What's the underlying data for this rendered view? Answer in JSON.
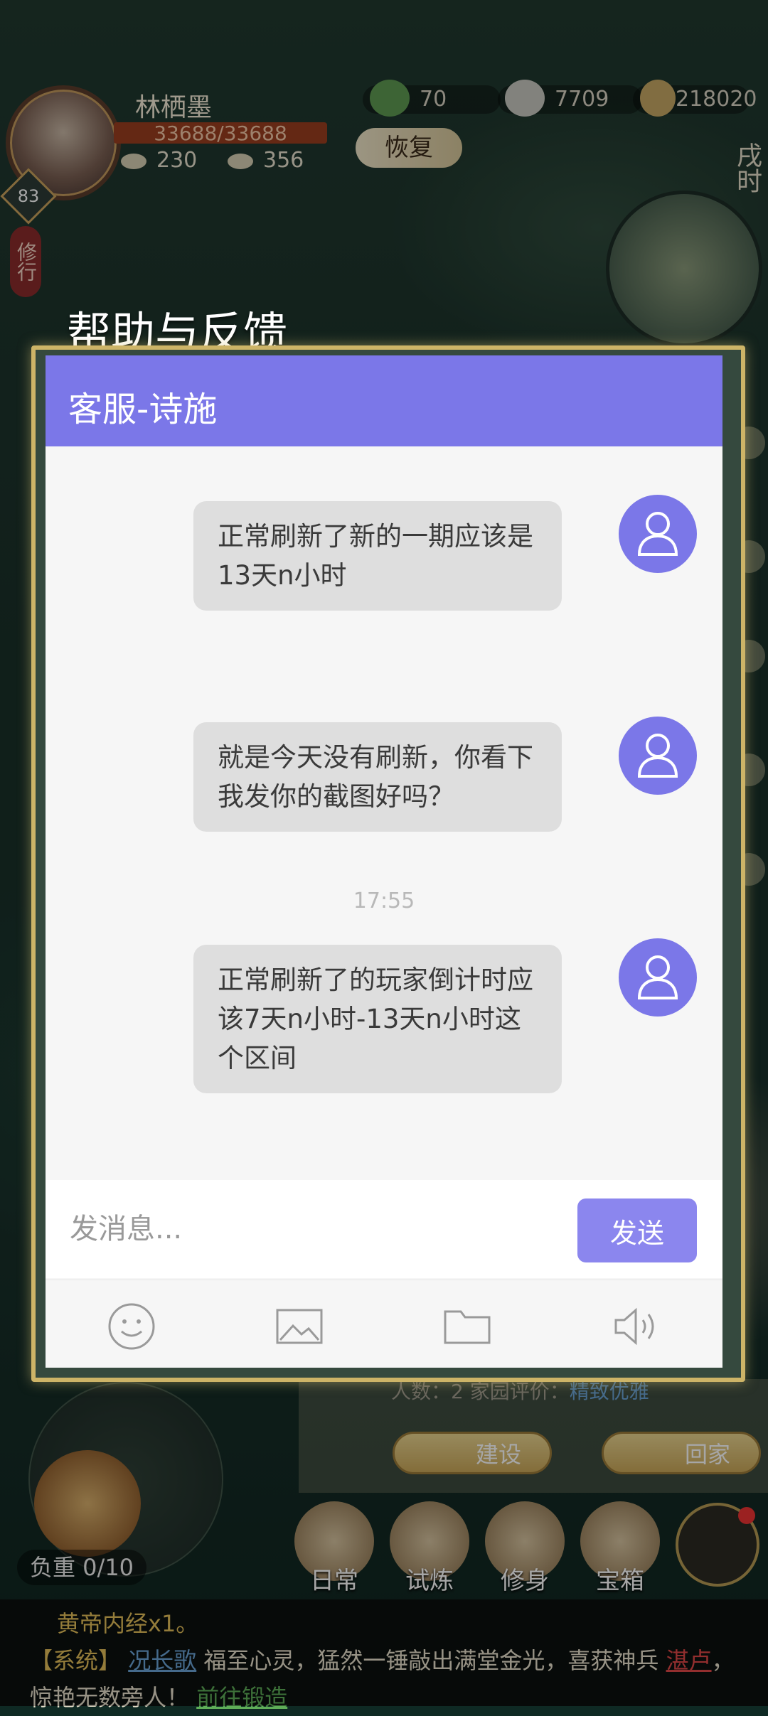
{
  "hud": {
    "player_name": "林栖墨",
    "hp": "33688/33688",
    "level": "83",
    "stat1": "230",
    "stat2": "356",
    "res_jade": "70",
    "res_ingot": "7709",
    "res_coin": "218020",
    "recover_label": "恢复",
    "xiuxing_label": "修行",
    "time_label": "戌时"
  },
  "dialog": {
    "title": "帮助与反馈",
    "header": "客服-诗施",
    "messages": [
      {
        "text": "正常刷新了新的一期应该是13天n小时"
      },
      {
        "text": "就是今天没有刷新，你看下我发你的截图好吗？"
      },
      {
        "text": "正常刷新了的玩家倒计时应该7天n小时-13天n小时这个区间"
      }
    ],
    "timestamp": "17:55",
    "input_placeholder": "发消息...",
    "send_label": "发送",
    "tools": [
      "emoji-icon",
      "image-icon",
      "folder-icon",
      "speaker-icon"
    ]
  },
  "bottom": {
    "info_label": "人数：",
    "info_count": "2",
    "info_eval": "家园评价：",
    "info_eval_value": "精致优雅",
    "build_label": "建设",
    "home_label": "回家",
    "weight": "负重 0/10",
    "nav": [
      "日常",
      "试炼",
      "修身",
      "宝箱"
    ]
  },
  "log": {
    "line1": "黄帝内经x1。",
    "sys_tag": "【系统】",
    "player": "况长歌",
    "text1": "福至心灵，猛然一锤敲出满堂金光，喜获神兵",
    "item": "湛卢",
    "text2": "，惊艳无数旁人！",
    "link": "前往锻造"
  },
  "colors": {
    "header": "#7b77e8",
    "send": "#8b86ee",
    "bubble": "#dedede",
    "frame": "#cdb467"
  }
}
